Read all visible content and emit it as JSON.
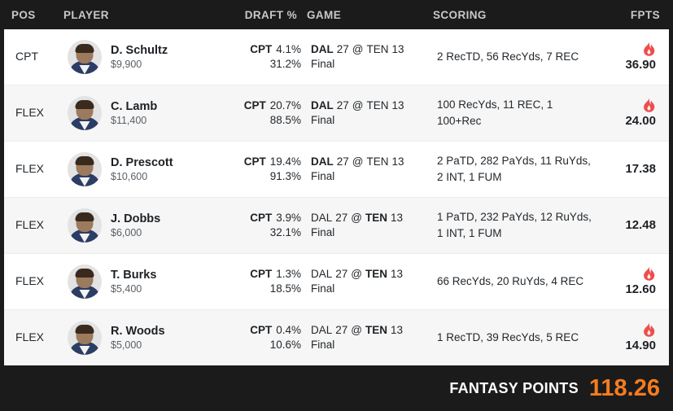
{
  "header": {
    "columns": [
      {
        "key": "pos",
        "label": "POS"
      },
      {
        "key": "player",
        "label": "PLAYER"
      },
      {
        "key": "draft",
        "label": "DRAFT %"
      },
      {
        "key": "game",
        "label": "GAME"
      },
      {
        "key": "scoring",
        "label": "SCORING"
      },
      {
        "key": "fpts",
        "label": "FPTS"
      }
    ]
  },
  "rows": [
    {
      "pos": "CPT",
      "name": "D. Schultz",
      "salary": "$9,900",
      "draft_cpt_tag": "CPT",
      "draft_cpt_pct": "4.1%",
      "draft_flex_pct": "31.2%",
      "game_away_team": "DAL",
      "game_away_score": "27",
      "game_at": "@",
      "game_home_team": "TEN",
      "game_home_score": "13",
      "game_highlight": "away",
      "game_status": "Final",
      "scoring": "2 RecTD, 56 RecYds, 7 REC",
      "fpts": "36.90",
      "hot": true,
      "alt": false
    },
    {
      "pos": "FLEX",
      "name": "C. Lamb",
      "salary": "$11,400",
      "draft_cpt_tag": "CPT",
      "draft_cpt_pct": "20.7%",
      "draft_flex_pct": "88.5%",
      "game_away_team": "DAL",
      "game_away_score": "27",
      "game_at": "@",
      "game_home_team": "TEN",
      "game_home_score": "13",
      "game_highlight": "away",
      "game_status": "Final",
      "scoring": "100 RecYds, 11 REC, 1 100+Rec",
      "fpts": "24.00",
      "hot": true,
      "alt": true
    },
    {
      "pos": "FLEX",
      "name": "D. Prescott",
      "salary": "$10,600",
      "draft_cpt_tag": "CPT",
      "draft_cpt_pct": "19.4%",
      "draft_flex_pct": "91.3%",
      "game_away_team": "DAL",
      "game_away_score": "27",
      "game_at": "@",
      "game_home_team": "TEN",
      "game_home_score": "13",
      "game_highlight": "away",
      "game_status": "Final",
      "scoring": "2 PaTD, 282 PaYds, 11 RuYds, 2 INT, 1 FUM",
      "fpts": "17.38",
      "hot": false,
      "alt": false
    },
    {
      "pos": "FLEX",
      "name": "J. Dobbs",
      "salary": "$6,000",
      "draft_cpt_tag": "CPT",
      "draft_cpt_pct": "3.9%",
      "draft_flex_pct": "32.1%",
      "game_away_team": "DAL",
      "game_away_score": "27",
      "game_at": "@",
      "game_home_team": "TEN",
      "game_home_score": "13",
      "game_highlight": "home",
      "game_status": "Final",
      "scoring": "1 PaTD, 232 PaYds, 12 RuYds, 1 INT, 1 FUM",
      "fpts": "12.48",
      "hot": false,
      "alt": true
    },
    {
      "pos": "FLEX",
      "name": "T. Burks",
      "salary": "$5,400",
      "draft_cpt_tag": "CPT",
      "draft_cpt_pct": "1.3%",
      "draft_flex_pct": "18.5%",
      "game_away_team": "DAL",
      "game_away_score": "27",
      "game_at": "@",
      "game_home_team": "TEN",
      "game_home_score": "13",
      "game_highlight": "home",
      "game_status": "Final",
      "scoring": "66 RecYds, 20 RuYds, 4 REC",
      "fpts": "12.60",
      "hot": true,
      "alt": false
    },
    {
      "pos": "FLEX",
      "name": "R. Woods",
      "salary": "$5,000",
      "draft_cpt_tag": "CPT",
      "draft_cpt_pct": "0.4%",
      "draft_flex_pct": "10.6%",
      "game_away_team": "DAL",
      "game_away_score": "27",
      "game_at": "@",
      "game_home_team": "TEN",
      "game_home_score": "13",
      "game_highlight": "home",
      "game_status": "Final",
      "scoring": "1 RecTD, 39 RecYds, 5 REC",
      "fpts": "14.90",
      "hot": true,
      "alt": true
    }
  ],
  "footer": {
    "label": "FANTASY POINTS",
    "total": "118.26"
  },
  "colors": {
    "header_bg": "#1b1b1b",
    "header_text": "#c9c9c9",
    "row_bg": "#ffffff",
    "row_alt_bg": "#f6f6f6",
    "text": "#23282d",
    "muted_text": "#5a6066",
    "flame": "#ef4d4d",
    "total_accent": "#f57c1f"
  }
}
